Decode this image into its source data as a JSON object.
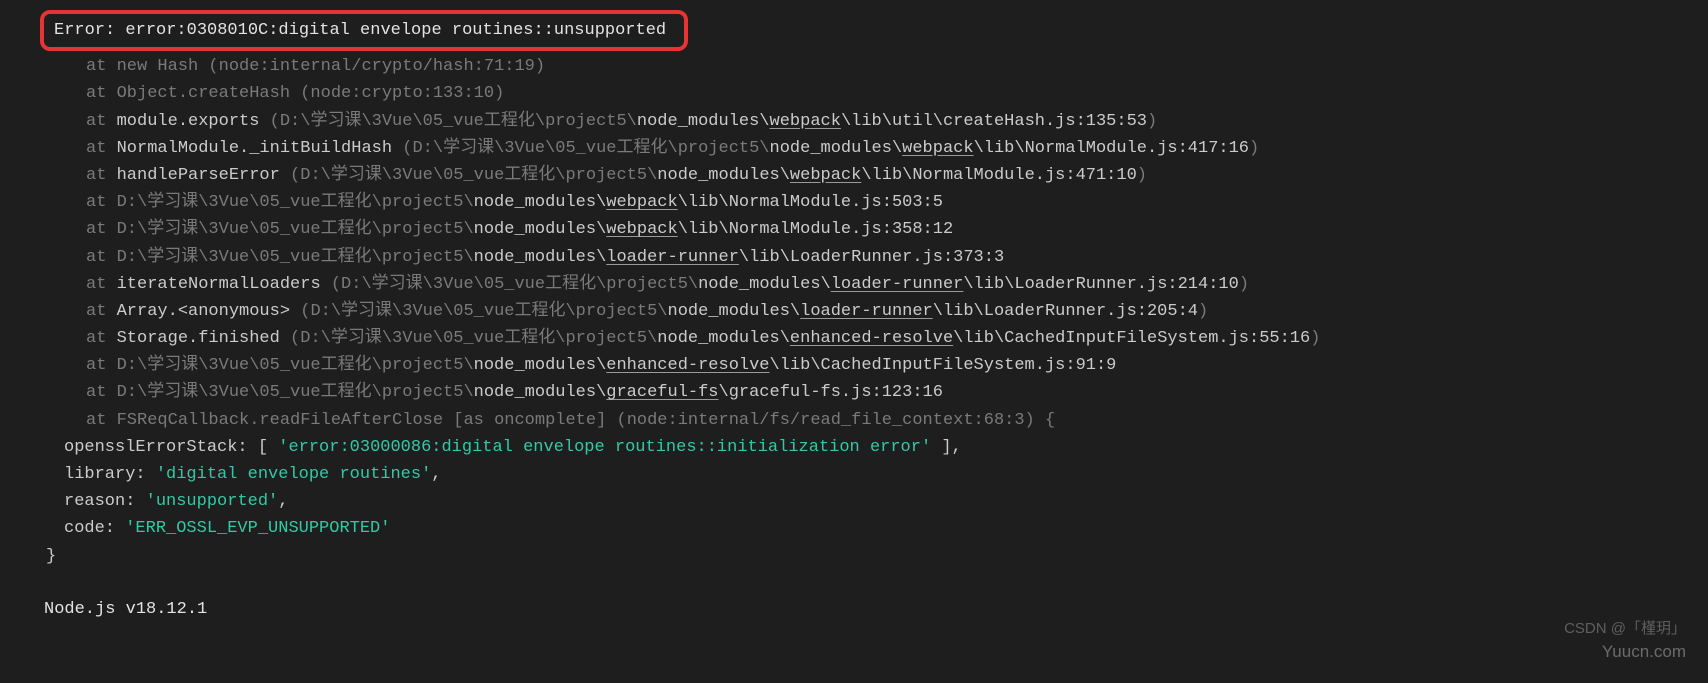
{
  "error_line": "Error: error:0308010C:digital envelope routines::unsupported",
  "traces": [
    {
      "dim_l": "at new Hash (node:internal/crypto/hash:71:19)",
      "mid": [],
      "dim_r": ""
    },
    {
      "dim_l": "at Object.createHash (node:crypto:133:10)",
      "mid": [],
      "dim_r": ""
    },
    {
      "dim_l": "at ",
      "mid": [
        {
          "t": "module.exports ",
          "u": false
        },
        {
          "t": "(D:\\学习课\\3Vue\\05_vue工程化\\project5\\",
          "u": false,
          "dim": true
        },
        {
          "t": "node_modules\\",
          "u": false
        },
        {
          "t": "webpack",
          "u": true
        },
        {
          "t": "\\lib\\util\\createHash.js:135:53",
          "u": false
        }
      ],
      "dim_r": ")"
    },
    {
      "dim_l": "at ",
      "mid": [
        {
          "t": "NormalModule._initBuildHash ",
          "u": false
        },
        {
          "t": "(D:\\学习课\\3Vue\\05_vue工程化\\project5\\",
          "u": false,
          "dim": true
        },
        {
          "t": "node_modules\\",
          "u": false
        },
        {
          "t": "webpack",
          "u": true
        },
        {
          "t": "\\lib\\NormalModule.js:417:16",
          "u": false
        }
      ],
      "dim_r": ")"
    },
    {
      "dim_l": "at ",
      "mid": [
        {
          "t": "handleParseError ",
          "u": false
        },
        {
          "t": "(D:\\学习课\\3Vue\\05_vue工程化\\project5\\",
          "u": false,
          "dim": true
        },
        {
          "t": "node_modules\\",
          "u": false
        },
        {
          "t": "webpack",
          "u": true
        },
        {
          "t": "\\lib\\NormalModule.js:471:10",
          "u": false
        }
      ],
      "dim_r": ")"
    },
    {
      "dim_l": "at ",
      "mid": [
        {
          "t": "D:\\学习课\\3Vue\\05_vue工程化\\project5\\",
          "u": false,
          "dim": true
        },
        {
          "t": "node_modules\\",
          "u": false
        },
        {
          "t": "webpack",
          "u": true
        },
        {
          "t": "\\lib\\NormalModule.js:503:5",
          "u": false
        }
      ],
      "dim_r": ""
    },
    {
      "dim_l": "at ",
      "mid": [
        {
          "t": "D:\\学习课\\3Vue\\05_vue工程化\\project5\\",
          "u": false,
          "dim": true
        },
        {
          "t": "node_modules\\",
          "u": false
        },
        {
          "t": "webpack",
          "u": true
        },
        {
          "t": "\\lib\\NormalModule.js:358:12",
          "u": false
        }
      ],
      "dim_r": ""
    },
    {
      "dim_l": "at ",
      "mid": [
        {
          "t": "D:\\学习课\\3Vue\\05_vue工程化\\project5\\",
          "u": false,
          "dim": true
        },
        {
          "t": "node_modules\\",
          "u": false
        },
        {
          "t": "loader-runner",
          "u": true
        },
        {
          "t": "\\lib\\LoaderRunner.js:373:3",
          "u": false
        }
      ],
      "dim_r": ""
    },
    {
      "dim_l": "at ",
      "mid": [
        {
          "t": "iterateNormalLoaders ",
          "u": false
        },
        {
          "t": "(D:\\学习课\\3Vue\\05_vue工程化\\project5\\",
          "u": false,
          "dim": true
        },
        {
          "t": "node_modules\\",
          "u": false
        },
        {
          "t": "loader-runner",
          "u": true
        },
        {
          "t": "\\lib\\LoaderRunner.js:214:10",
          "u": false
        }
      ],
      "dim_r": ")"
    },
    {
      "dim_l": "at ",
      "mid": [
        {
          "t": "Array.<anonymous> ",
          "u": false
        },
        {
          "t": "(D:\\学习课\\3Vue\\05_vue工程化\\project5\\",
          "u": false,
          "dim": true
        },
        {
          "t": "node_modules\\",
          "u": false
        },
        {
          "t": "loader-runner",
          "u": true
        },
        {
          "t": "\\lib\\LoaderRunner.js:205:4",
          "u": false
        }
      ],
      "dim_r": ")"
    },
    {
      "dim_l": "at ",
      "mid": [
        {
          "t": "Storage.finished ",
          "u": false
        },
        {
          "t": "(D:\\学习课\\3Vue\\05_vue工程化\\project5\\",
          "u": false,
          "dim": true
        },
        {
          "t": "node_modules\\",
          "u": false
        },
        {
          "t": "enhanced-resolve",
          "u": true
        },
        {
          "t": "\\lib\\CachedInputFileSystem.js:55:16",
          "u": false
        }
      ],
      "dim_r": ")"
    },
    {
      "dim_l": "at ",
      "mid": [
        {
          "t": "D:\\学习课\\3Vue\\05_vue工程化\\project5\\",
          "u": false,
          "dim": true
        },
        {
          "t": "node_modules\\",
          "u": false
        },
        {
          "t": "enhanced-resolve",
          "u": true
        },
        {
          "t": "\\lib\\CachedInputFileSystem.js:91:9",
          "u": false
        }
      ],
      "dim_r": ""
    },
    {
      "dim_l": "at ",
      "mid": [
        {
          "t": "D:\\学习课\\3Vue\\05_vue工程化\\project5\\",
          "u": false,
          "dim": true
        },
        {
          "t": "node_modules\\",
          "u": false
        },
        {
          "t": "graceful-fs",
          "u": true
        },
        {
          "t": "\\graceful-fs.js:123:16",
          "u": false
        }
      ],
      "dim_r": ""
    },
    {
      "dim_l": "at FSReqCallback.readFileAfterClose [as oncomplete] (node:internal/fs/read_file_context:68:3) {",
      "mid": [],
      "dim_r": ""
    }
  ],
  "props": {
    "openssl_k": "opensslErrorStack: [ ",
    "openssl_v": "'error:03000086:digital envelope routines::initialization error'",
    "openssl_e": " ],",
    "library_k": "library: ",
    "library_v": "'digital envelope routines'",
    "library_e": ",",
    "reason_k": "reason: ",
    "reason_v": "'unsupported'",
    "reason_e": ",",
    "code_k": "code: ",
    "code_v": "'ERR_OSSL_EVP_UNSUPPORTED'"
  },
  "close_brace": "}",
  "node_version": "Node.js v18.12.1",
  "watermark_csdn": "CSDN @「槿玥」",
  "watermark_site": "Yuucn.com"
}
